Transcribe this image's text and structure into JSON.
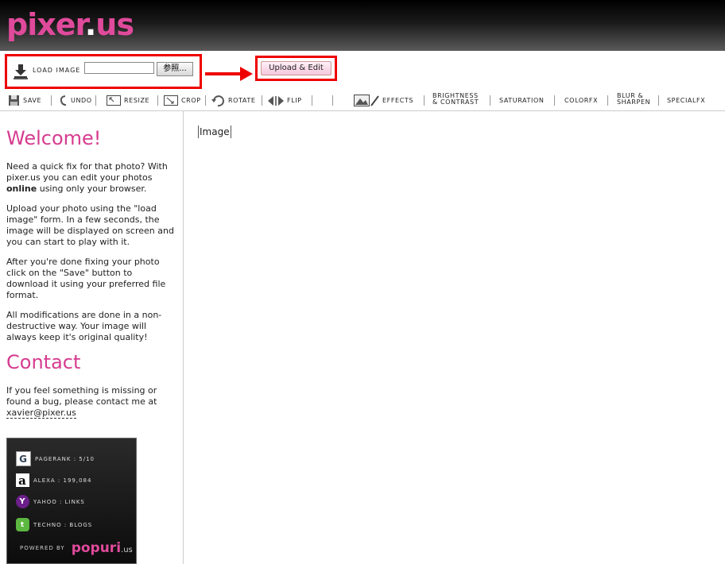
{
  "header": {
    "logo_main": "pixer",
    "logo_dot": ".",
    "logo_tld": "us"
  },
  "loadbar": {
    "load_label": "LOAD IMAGE",
    "file_value": "",
    "browse_label": "参照...",
    "upload_label": "Upload & Edit"
  },
  "toolbar": {
    "save": "SAVE",
    "undo": "UNDO",
    "resize": "RESIZE",
    "crop": "CROP",
    "rotate": "ROTATE",
    "flip": "FLIP",
    "effects": "EFFECTS",
    "brightness_line1": "BRIGHTNESS",
    "brightness_line2": "& CONTRAST",
    "saturation": "SATURATION",
    "colorfx": "COLORFX",
    "blur_line1": "BLUR &",
    "blur_line2": "SHARPEN",
    "specialfx": "SPECIALFX"
  },
  "sidebar": {
    "welcome_heading": "Welcome!",
    "p1_a": "Need a quick fix for that photo? With pixer.us you can edit your photos ",
    "p1_bold": "online",
    "p1_b": " using only your browser.",
    "p2": "Upload your photo using the \"load image\" form. In a few seconds, the image will be displayed on screen and you can start to play with it.",
    "p3": "After you're done fixing your photo click on the \"Save\" button to download it using your preferred file format.",
    "p4": "All modifications are done in a non-destructive way. Your image will always keep it's original quality!",
    "contact_heading": "Contact",
    "contact_text": "If you feel something is missing or found a bug, please contact me at ",
    "email": "xavier@pixer.us"
  },
  "badge": {
    "pagerank": "PAGERANK : 5/10",
    "alexa": "ALEXA : 199,084",
    "yahoo": "YAHOO : LINKS",
    "techno": "TECHNO : BLOGS",
    "powered": "POWERED BY",
    "popuri_main": "popuri",
    "popuri_tld": ".us"
  },
  "main": {
    "image_alt": "Image"
  },
  "colors": {
    "accent": "#d63c8f",
    "highlight_red": "#e00000"
  }
}
